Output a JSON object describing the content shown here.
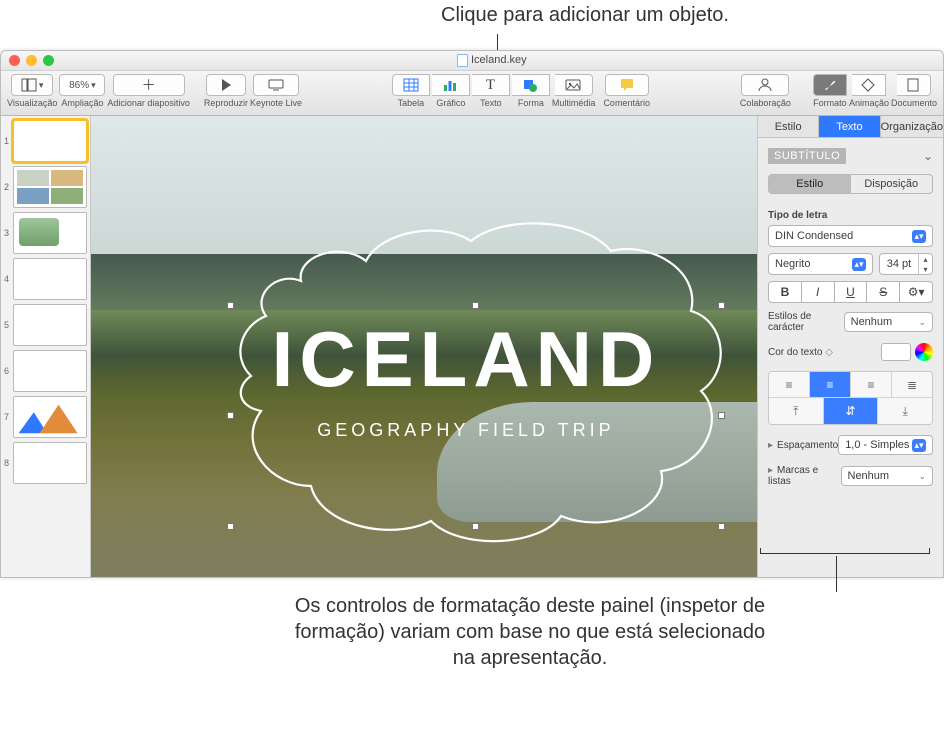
{
  "callouts": {
    "top": "Clique para adicionar um objeto.",
    "bottom": "Os controlos de formatação deste painel (inspetor de formação) variam com base no que está selecionado na apresentação."
  },
  "window": {
    "title": "Iceland.key"
  },
  "toolbar": {
    "view": "Visualização",
    "zoom": "Ampliação",
    "zoom_value": "86%",
    "add_slide": "Adicionar diapositivo",
    "play": "Reproduzir",
    "keynote_live": "Keynote Live",
    "table": "Tabela",
    "chart": "Gráfico",
    "text": "Texto",
    "shape": "Forma",
    "media": "Multimédia",
    "comment": "Comentário",
    "collab": "Colaboração",
    "format": "Formato",
    "animation": "Animação",
    "document": "Documento"
  },
  "slide": {
    "title": "ICELAND",
    "subtitle": "GEOGRAPHY FIELD TRIP"
  },
  "thumbs": [
    "1",
    "2",
    "3",
    "4",
    "5",
    "6",
    "7",
    "8"
  ],
  "inspector": {
    "tab_style": "Estilo",
    "tab_text": "Texto",
    "tab_arrange": "Organização",
    "paragraph_style": "SUBTÍTULO",
    "seg_style": "Estilo",
    "seg_layout": "Disposição",
    "font_label": "Tipo de letra",
    "font_family": "DIN Condensed",
    "font_weight": "Negrito",
    "font_size": "34 pt",
    "bold": "B",
    "italic": "I",
    "underline": "U",
    "strike": "S",
    "char_styles_label": "Estilos de carácter",
    "char_styles_value": "Nenhum",
    "text_color_label": "Cor do texto",
    "spacing_label": "Espaçamento",
    "spacing_value": "1,0 - Simples",
    "bullets_label": "Marcas e listas",
    "bullets_value": "Nenhum"
  }
}
